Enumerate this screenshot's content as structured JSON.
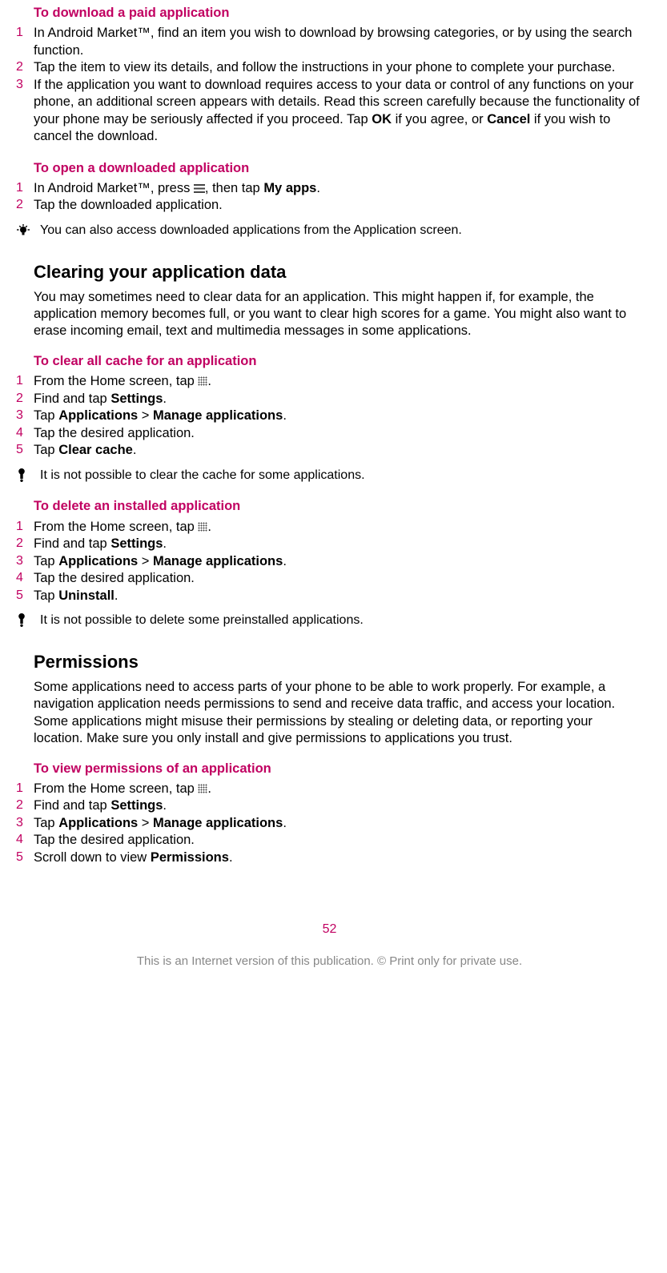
{
  "sec1": {
    "heading": "To download a paid application",
    "steps": [
      "In Android Market™, find an item you wish to download by browsing categories, or by using the search function.",
      "Tap the item to view its details, and follow the instructions in your phone to complete your purchase.",
      ""
    ],
    "step3_pre": "If the application you want to download requires access to your data or control of any functions on your phone, an additional screen appears with details. Read this screen carefully because the functionality of your phone may be seriously affected if you proceed. Tap ",
    "step3_ok": "OK",
    "step3_mid": " if you agree, or ",
    "step3_cancel": "Cancel",
    "step3_end": " if you wish to cancel the download."
  },
  "sec2": {
    "heading": "To open a downloaded application",
    "step1_pre": "In Android Market™, press ",
    "step1_mid": ", then tap ",
    "step1_myapps": "My apps",
    "step1_end": ".",
    "step2": "Tap the downloaded application.",
    "tip": "You can also access downloaded applications from the Application screen."
  },
  "sec3": {
    "heading": "Clearing your application data",
    "para": "You may sometimes need to clear data for an application. This might happen if, for example, the application memory becomes full, or you want to clear high scores for a game. You might also want to erase incoming email, text and multimedia messages in some applications."
  },
  "sec4": {
    "heading": "To clear all cache for an application",
    "step1_pre": "From the Home screen, tap ",
    "step1_end": ".",
    "step2_pre": "Find and tap ",
    "step2_b": "Settings",
    "step2_end": ".",
    "step3_pre": "Tap ",
    "step3_b1": "Applications",
    "step3_gt": " > ",
    "step3_b2": "Manage applications",
    "step3_end": ".",
    "step4": "Tap the desired application.",
    "step5_pre": "Tap ",
    "step5_b": "Clear cache",
    "step5_end": ".",
    "warn": "It is not possible to clear the cache for some applications."
  },
  "sec5": {
    "heading": "To delete an installed application",
    "step1_pre": "From the Home screen, tap ",
    "step1_end": ".",
    "step2_pre": "Find and tap ",
    "step2_b": "Settings",
    "step2_end": ".",
    "step3_pre": "Tap ",
    "step3_b1": "Applications",
    "step3_gt": " > ",
    "step3_b2": "Manage applications",
    "step3_end": ".",
    "step4": "Tap the desired application.",
    "step5_pre": "Tap ",
    "step5_b": "Uninstall",
    "step5_end": ".",
    "warn": "It is not possible to delete some preinstalled applications."
  },
  "sec6": {
    "heading": "Permissions",
    "para": "Some applications need to access parts of your phone to be able to work properly. For example, a navigation application needs permissions to send and receive data traffic, and access your location. Some applications might misuse their permissions by stealing or deleting data, or reporting your location. Make sure you only install and give permissions to applications you trust."
  },
  "sec7": {
    "heading": "To view permissions of an application",
    "step1_pre": "From the Home screen, tap ",
    "step1_end": ".",
    "step2_pre": "Find and tap ",
    "step2_b": "Settings",
    "step2_end": ".",
    "step3_pre": "Tap ",
    "step3_b1": "Applications",
    "step3_gt": " > ",
    "step3_b2": "Manage applications",
    "step3_end": ".",
    "step4": "Tap the desired application.",
    "step5_pre": "Scroll down to view ",
    "step5_b": "Permissions",
    "step5_end": "."
  },
  "pageNum": "52",
  "footer": "This is an Internet version of this publication. © Print only for private use."
}
